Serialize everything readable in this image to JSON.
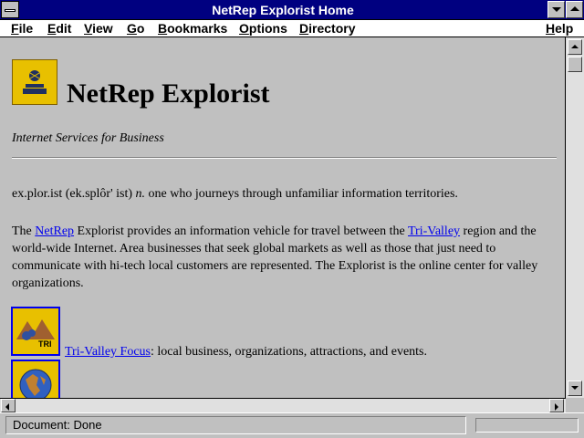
{
  "window": {
    "title": "NetRep Explorist Home"
  },
  "menu": {
    "file": "File",
    "edit": "Edit",
    "view": "View",
    "go": "Go",
    "bookmarks": "Bookmarks",
    "options": "Options",
    "directory": "Directory",
    "help": "Help"
  },
  "page": {
    "title": "NetRep Explorist",
    "tagline": "Internet Services for Business",
    "definition": {
      "word": "ex.plor.ist (ek.splôr' ist)",
      "pos": "n.",
      "meaning": "one who journeys through unfamiliar information territories."
    },
    "intro": {
      "p1_before": "The ",
      "netrep_link": "NetRep",
      "p1_mid": " Explorist provides an information vehicle for travel between the ",
      "trivalley_link": "Tri-Valley",
      "p1_after": " region and the world-wide Internet. Area businesses that seek global markets as well as those that just need to communicate with hi-tech local customers are represented. The Explorist is the online center for valley organizations."
    },
    "links": {
      "tri_icon_text": "TRI",
      "tri_focus_link": "Tri-Valley Focus",
      "tri_focus_desc": ": local business, organizations, attractions, and events."
    }
  },
  "status": {
    "text": "Document: Done"
  },
  "colors": {
    "titlebar": "#000080",
    "link": "#0000ee",
    "icon_gold": "#e8c000",
    "background": "#c0c0c0"
  }
}
